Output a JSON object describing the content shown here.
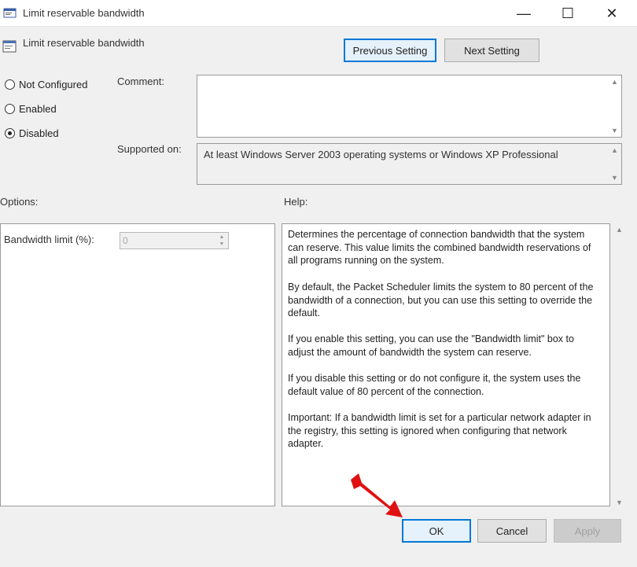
{
  "window": {
    "title": "Limit reservable bandwidth",
    "controls": {
      "minimize": "—",
      "maximize": "☐",
      "close": "✕"
    }
  },
  "header": {
    "setting_name": "Limit reservable bandwidth",
    "previous_label": "Previous Setting",
    "next_label": "Next Setting"
  },
  "state": {
    "options": [
      {
        "label": "Not Configured",
        "selected": false
      },
      {
        "label": "Enabled",
        "selected": false
      },
      {
        "label": "Disabled",
        "selected": true
      }
    ]
  },
  "comment": {
    "label": "Comment:",
    "value": ""
  },
  "supported": {
    "label": "Supported on:",
    "value": "At least Windows Server 2003 operating systems or Windows XP Professional"
  },
  "options_section": {
    "label": "Options:",
    "bandwidth_label": "Bandwidth limit (%):",
    "bandwidth_value": "0"
  },
  "help_section": {
    "label": "Help:",
    "paragraphs": [
      "Determines the percentage of connection bandwidth that the system can reserve. This value limits the combined bandwidth reservations of all programs running on the system.",
      "By default, the Packet Scheduler limits the system to 80 percent of the bandwidth of a connection, but you can use this setting to override the default.",
      "If you enable this setting, you can use the \"Bandwidth limit\" box to adjust the amount of bandwidth the system can reserve.",
      "If you disable this setting or do not configure it, the system uses the default value of 80 percent of the connection.",
      "Important: If a bandwidth limit is set for a particular network adapter in the registry, this setting is ignored when configuring that network adapter."
    ]
  },
  "footer": {
    "ok_label": "OK",
    "cancel_label": "Cancel",
    "apply_label": "Apply"
  },
  "colors": {
    "annotation_arrow": "#e01010",
    "focus_border": "#0078d7"
  }
}
